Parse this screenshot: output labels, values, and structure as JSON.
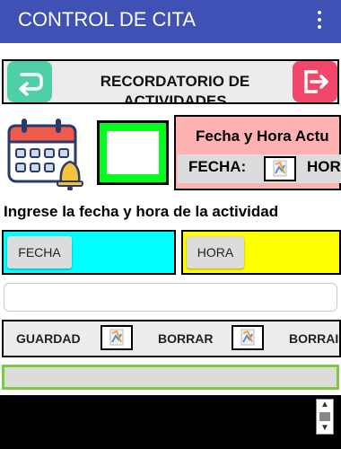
{
  "app_bar": {
    "title": "CONTROL DE CITA",
    "menu_icon": "kebab-menu-icon"
  },
  "header": {
    "title": "RECORDATORIO DE ACTIVIDADES",
    "back_icon": "back-arrow-icon",
    "exit_icon": "exit-icon"
  },
  "reminder_panel": {
    "title": "Fecha y Hora Actu",
    "date_label": "FECHA:",
    "time_label": "HOR"
  },
  "prompt": "Ingrese la fecha y hora de la actividad",
  "pickers": {
    "date_button": "FECHA",
    "time_button": "HORA"
  },
  "note_input": {
    "value": "",
    "placeholder": ""
  },
  "actions": {
    "save": "GUARDAD",
    "delete_1": "BORRAR",
    "delete_2": "BORRAI"
  },
  "colors": {
    "app_bar": "#3f51b5",
    "date_panel": "#00ffff",
    "time_panel": "#ffff00",
    "reminder_panel": "#ffb2b2",
    "status_box": "#00ff1e",
    "list_border": "#7ec93f"
  }
}
